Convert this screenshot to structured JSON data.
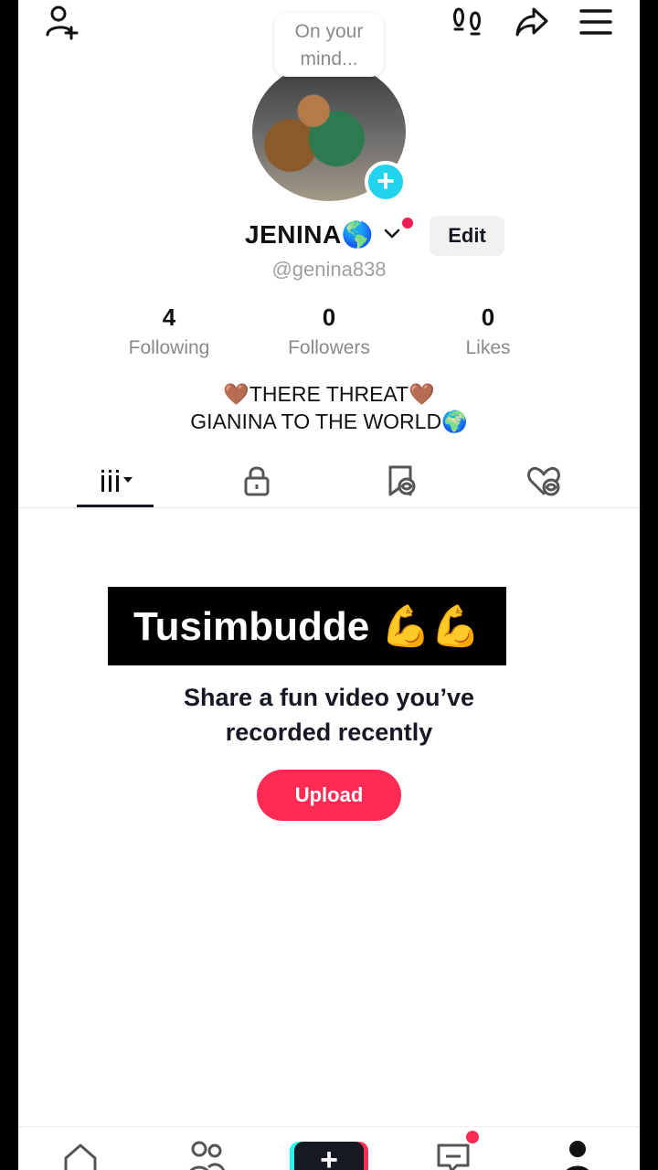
{
  "header": {
    "thought_bubble": "On your mind...",
    "icons": [
      "add-friend-icon",
      "footprints-icon",
      "share-icon",
      "menu-icon"
    ]
  },
  "profile": {
    "display_name": "JENINA🌎",
    "handle": "@genina838",
    "edit_label": "Edit"
  },
  "stats": [
    {
      "value": "4",
      "label": "Following"
    },
    {
      "value": "0",
      "label": "Followers"
    },
    {
      "value": "0",
      "label": "Likes"
    }
  ],
  "bio": {
    "line1": "🤎THERE THREAT🤎",
    "line2": "GIANINA TO THE WORLD🌍"
  },
  "tabs": [
    "videos-grid-icon",
    "lock-icon",
    "reposts-icon",
    "liked-icon"
  ],
  "overlay_caption": "Tusimbudde 💪💪",
  "empty_state": {
    "line1": "Share a fun video you’ve",
    "line2": "recorded recently",
    "button_label": "Upload"
  },
  "bottom_nav": {
    "create_label": "+"
  },
  "colors": {
    "accent": "#fe2c55",
    "cyan": "#25f4ee"
  }
}
